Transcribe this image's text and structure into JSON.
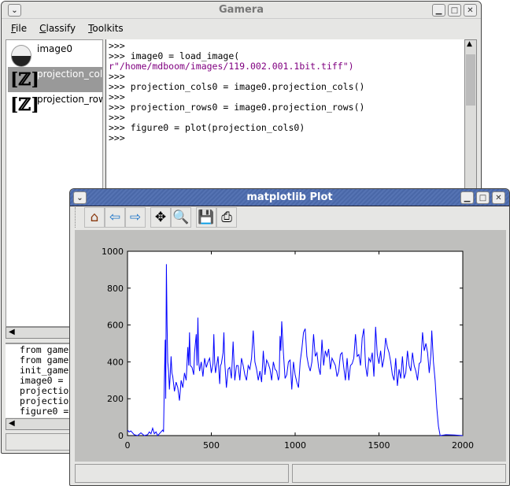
{
  "gamera": {
    "title": "Gamera",
    "menu": [
      "File",
      "Classify",
      "Toolkits"
    ],
    "objects": [
      {
        "label": "image0",
        "icon": "image-file-icon"
      },
      {
        "label": "projection_col",
        "icon": "projection-icon",
        "selected": true
      },
      {
        "label": "projection_row",
        "icon": "projection-icon"
      }
    ],
    "shell": [
      {
        "p": ">>>",
        "t": ""
      },
      {
        "p": ">>>",
        "t": " image0 = load_image("
      },
      {
        "p": "",
        "t": "r\"/home/mdboom/images/119.002.001.1bit.tiff\")",
        "str": true
      },
      {
        "p": ">>>",
        "t": ""
      },
      {
        "p": ">>>",
        "t": " projection_cols0 = image0.projection_cols()"
      },
      {
        "p": ">>>",
        "t": ""
      },
      {
        "p": ">>>",
        "t": " projection_rows0 = image0.projection_rows()"
      },
      {
        "p": ">>>",
        "t": ""
      },
      {
        "p": ">>>",
        "t": " figure0 = plot(projection_cols0)"
      },
      {
        "p": ">>>",
        "t": ""
      }
    ],
    "history": [
      "from game",
      "from game",
      "init_game",
      "image0 = l",
      "projection",
      "projection",
      "figure0 ="
    ],
    "string_color": "#800080"
  },
  "plot": {
    "title": "matplotlib Plot",
    "toolbar": [
      {
        "name": "home-button",
        "icon": "home-icon",
        "glyph": "⌂"
      },
      {
        "name": "back-button",
        "icon": "arrow-left-icon",
        "glyph": "⇦"
      },
      {
        "name": "forward-button",
        "icon": "arrow-right-icon",
        "glyph": "⇨"
      },
      {
        "name": "pan-button",
        "icon": "move-icon",
        "glyph": "✥"
      },
      {
        "name": "zoom-button",
        "icon": "zoom-rect-icon",
        "glyph": "🔍"
      },
      {
        "name": "save-button",
        "icon": "floppy-icon",
        "glyph": "💾"
      },
      {
        "name": "print-button",
        "icon": "printer-icon",
        "glyph": "⎙"
      }
    ]
  },
  "chart_data": {
    "type": "line",
    "xlim": [
      0,
      2000
    ],
    "ylim": [
      0,
      1000
    ],
    "xticks": [
      0,
      500,
      1000,
      1500,
      2000
    ],
    "yticks": [
      0,
      200,
      400,
      600,
      800,
      1000
    ],
    "grid": false,
    "color": "#0000ff",
    "x": [
      0,
      10,
      20,
      40,
      60,
      80,
      100,
      120,
      130,
      140,
      150,
      160,
      170,
      180,
      190,
      200,
      210,
      215,
      220,
      225,
      228,
      232,
      236,
      240,
      245,
      250,
      255,
      260,
      265,
      270,
      280,
      290,
      300,
      310,
      320,
      330,
      340,
      350,
      360,
      365,
      370,
      375,
      385,
      395,
      400,
      410,
      415,
      420,
      425,
      430,
      440,
      450,
      460,
      470,
      480,
      490,
      500,
      510,
      515,
      520,
      525,
      535,
      540,
      550,
      555,
      560,
      570,
      575,
      580,
      590,
      600,
      610,
      620,
      630,
      640,
      650,
      660,
      670,
      680,
      690,
      700,
      710,
      720,
      730,
      740,
      750,
      760,
      770,
      780,
      790,
      800,
      810,
      820,
      830,
      840,
      850,
      860,
      870,
      880,
      890,
      900,
      905,
      910,
      915,
      920,
      930,
      940,
      950,
      960,
      970,
      980,
      990,
      1000,
      1010,
      1020,
      1030,
      1040,
      1050,
      1060,
      1070,
      1080,
      1090,
      1100,
      1110,
      1120,
      1130,
      1140,
      1150,
      1160,
      1170,
      1180,
      1190,
      1200,
      1210,
      1220,
      1230,
      1240,
      1250,
      1260,
      1270,
      1280,
      1290,
      1300,
      1310,
      1320,
      1330,
      1340,
      1350,
      1360,
      1370,
      1380,
      1390,
      1400,
      1410,
      1420,
      1430,
      1440,
      1450,
      1460,
      1470,
      1480,
      1490,
      1500,
      1510,
      1520,
      1530,
      1540,
      1550,
      1560,
      1570,
      1580,
      1590,
      1600,
      1610,
      1620,
      1630,
      1640,
      1650,
      1660,
      1670,
      1680,
      1690,
      1700,
      1710,
      1720,
      1730,
      1740,
      1750,
      1760,
      1770,
      1780,
      1790,
      1800,
      1810,
      1815,
      1825,
      1835,
      1845,
      1855,
      1865,
      1900,
      1950,
      2000
    ],
    "y": [
      30,
      20,
      25,
      5,
      0,
      15,
      0,
      5,
      20,
      10,
      40,
      10,
      20,
      0,
      10,
      20,
      30,
      20,
      300,
      520,
      200,
      930,
      600,
      400,
      350,
      250,
      330,
      430,
      340,
      320,
      240,
      290,
      260,
      190,
      300,
      260,
      340,
      300,
      480,
      380,
      560,
      380,
      370,
      330,
      450,
      550,
      380,
      640,
      400,
      350,
      400,
      320,
      420,
      370,
      400,
      420,
      340,
      390,
      550,
      400,
      340,
      400,
      430,
      280,
      380,
      390,
      450,
      560,
      400,
      260,
      360,
      370,
      310,
      510,
      300,
      380,
      380,
      300,
      420,
      380,
      330,
      300,
      380,
      360,
      420,
      570,
      400,
      360,
      300,
      350,
      290,
      460,
      330,
      410,
      390,
      360,
      300,
      400,
      360,
      350,
      300,
      320,
      540,
      460,
      620,
      450,
      310,
      330,
      400,
      410,
      250,
      400,
      330,
      290,
      260,
      400,
      470,
      560,
      580,
      430,
      380,
      350,
      400,
      550,
      430,
      450,
      370,
      330,
      520,
      380,
      460,
      430,
      470,
      360,
      420,
      400,
      380,
      320,
      350,
      440,
      450,
      370,
      300,
      420,
      300,
      380,
      390,
      420,
      550,
      430,
      440,
      380,
      530,
      580,
      380,
      320,
      420,
      400,
      450,
      320,
      590,
      440,
      390,
      460,
      370,
      420,
      530,
      480,
      450,
      400,
      330,
      300,
      420,
      270,
      360,
      310,
      430,
      310,
      340,
      460,
      380,
      350,
      450,
      380,
      350,
      300,
      390,
      400,
      560,
      460,
      500,
      450,
      340,
      440,
      570,
      400,
      300,
      150,
      50,
      0,
      5,
      3,
      0
    ]
  }
}
